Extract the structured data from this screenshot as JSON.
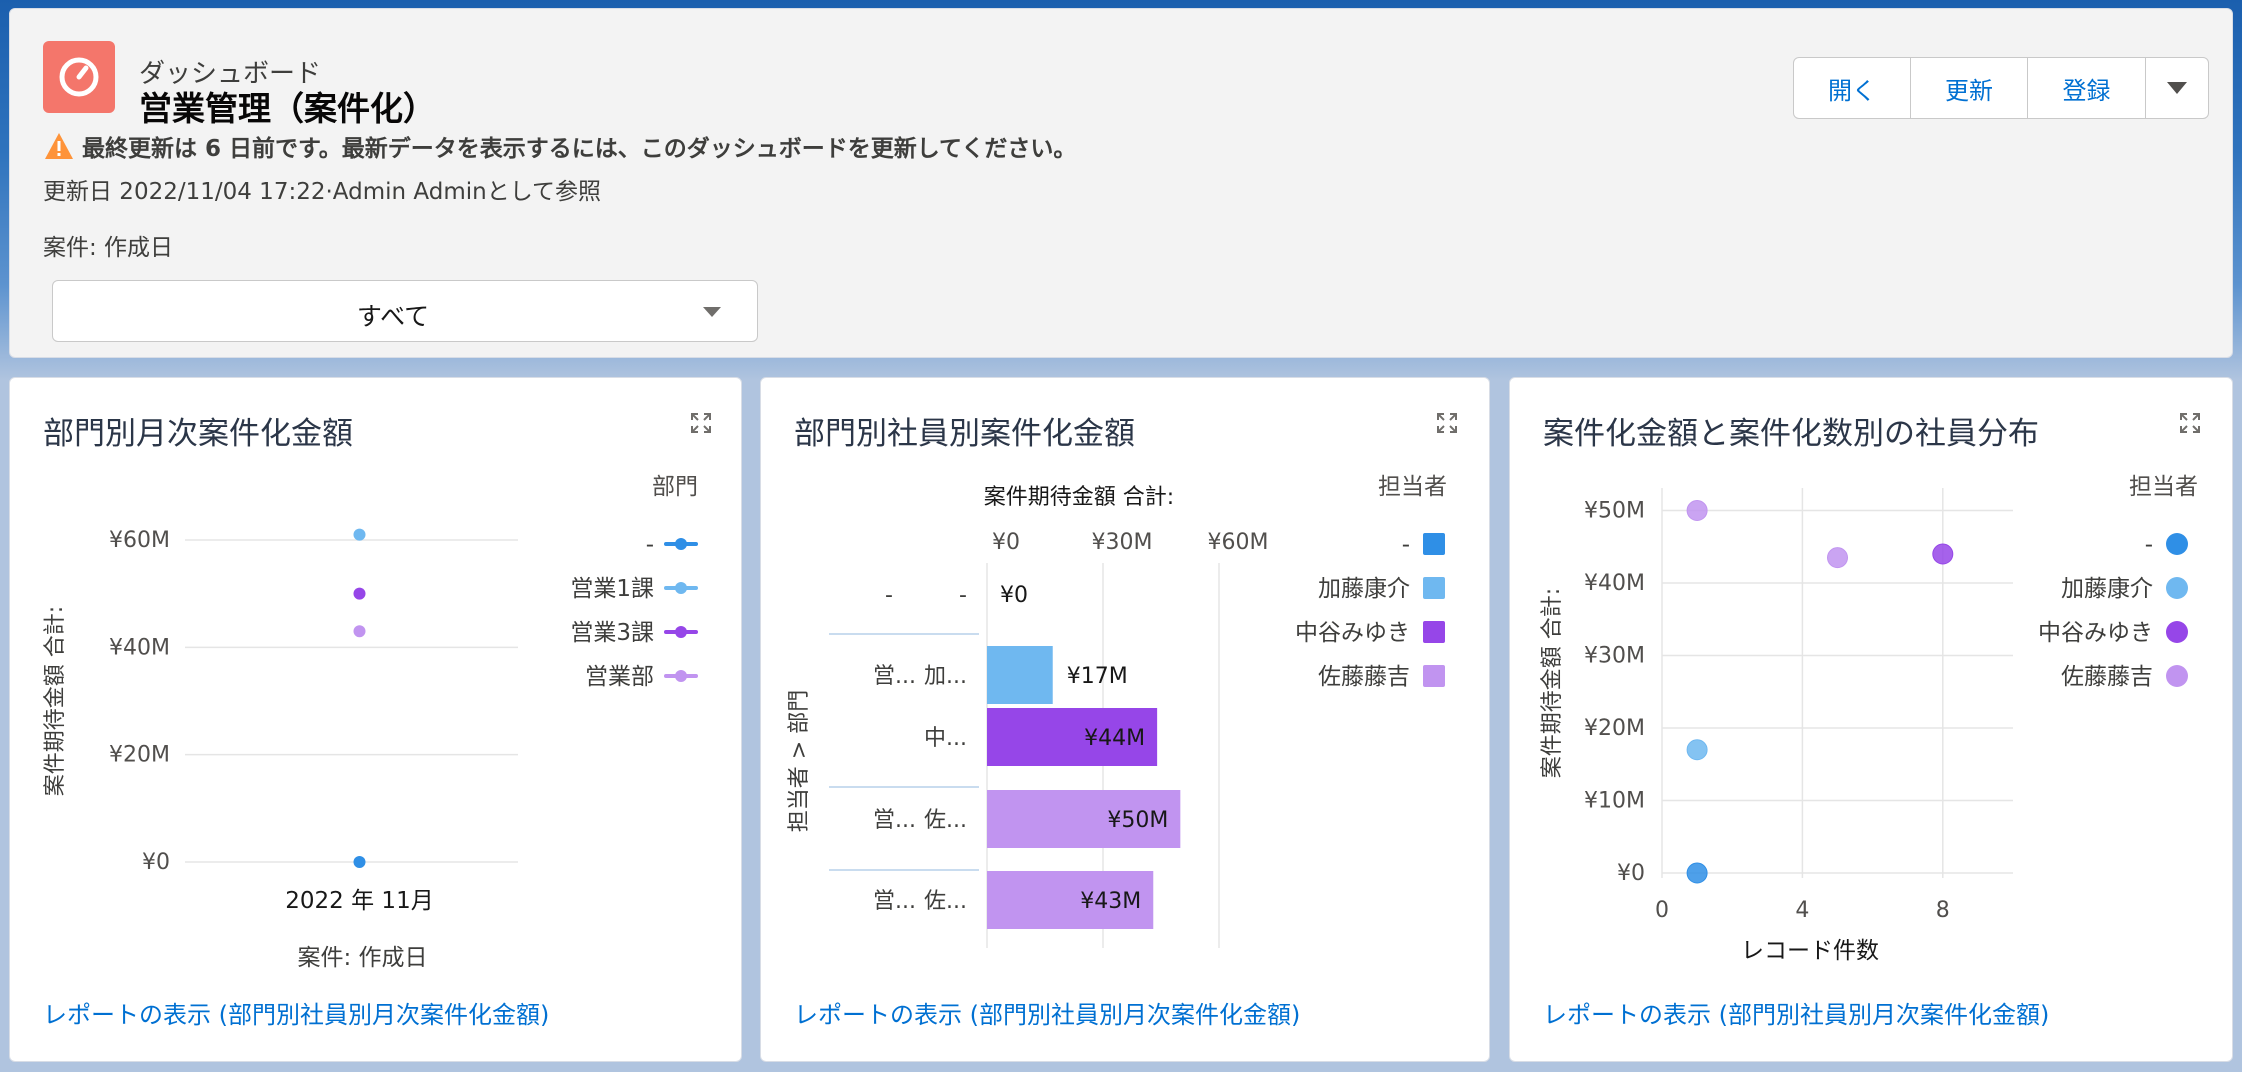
{
  "header": {
    "subtitle": "ダッシュボード",
    "title": "営業管理（案件化）",
    "warning": "最終更新は 6 日前です。最新データを表示するには、このダッシュボードを更新してください。",
    "updated": "更新日 2022/11/04 17:22·Admin Adminとして参照",
    "filter_label": "案件: 作成日",
    "filter_value": "すべて",
    "buttons": {
      "open": "開く",
      "refresh": "更新",
      "subscribe": "登録"
    }
  },
  "widgets": [
    {
      "title": "部門別月次案件化金額",
      "link": "レポートの表示 (部門別社員別月次案件化金額)",
      "chart_data": {
        "type": "scatter",
        "title": "部門別月次案件化金額",
        "xlabel": "案件: 作成日",
        "ylabel": "案件期待金額 合計:",
        "categories": [
          "2022 年 11月"
        ],
        "y_ticks": [
          "¥0",
          "¥20M",
          "¥40M",
          "¥60M"
        ],
        "ylim": [
          0,
          60
        ],
        "legend_title": "部門",
        "legend_position": "right",
        "series": [
          {
            "name": "-",
            "color": "#2f8fe6",
            "values": [
              0
            ]
          },
          {
            "name": "営業1課",
            "color": "#6fb8f0",
            "values": [
              61
            ]
          },
          {
            "name": "営業3課",
            "color": "#9646e8",
            "values": [
              50
            ]
          },
          {
            "name": "営業部",
            "color": "#c194f0",
            "values": [
              43
            ]
          }
        ]
      }
    },
    {
      "title": "部門別社員別案件化金額",
      "link": "レポートの表示 (部門別社員別月次案件化金額)",
      "chart_data": {
        "type": "bar",
        "title": "部門別社員別案件化金額",
        "xlabel": "案件期待金額 合計:",
        "ylabel": "担当者 > 部門",
        "x_ticks": [
          "¥0",
          "¥30M",
          "¥60M"
        ],
        "xlim": [
          0,
          60
        ],
        "legend_title": "担当者",
        "legend_position": "right",
        "rows": [
          {
            "dept": "-",
            "person": "-",
            "value": 0,
            "label": "¥0",
            "color": "#2f8fe6"
          },
          {
            "dept": "営...",
            "person": "加...",
            "value": 17,
            "label": "¥17M",
            "color": "#6fb8f0"
          },
          {
            "dept": "",
            "person": "中...",
            "value": 44,
            "label": "¥44M",
            "color": "#9646e8"
          },
          {
            "dept": "営...",
            "person": "佐...",
            "value": 50,
            "label": "¥50M",
            "color": "#c194f0"
          },
          {
            "dept": "営...",
            "person": "佐...",
            "value": 43,
            "label": "¥43M",
            "color": "#c194f0"
          }
        ],
        "legend": [
          {
            "name": "-",
            "color": "#2f8fe6"
          },
          {
            "name": "加藤康介",
            "color": "#6fb8f0"
          },
          {
            "name": "中谷みゆき",
            "color": "#9646e8"
          },
          {
            "name": "佐藤藤吉",
            "color": "#c194f0"
          }
        ]
      }
    },
    {
      "title": "案件化金額と案件化数別の社員分布",
      "link": "レポートの表示 (部門別社員別月次案件化金額)",
      "chart_data": {
        "type": "scatter",
        "title": "案件化金額と案件化数別の社員分布",
        "xlabel": "レコード件数",
        "ylabel": "案件期待金額 合計:",
        "x_ticks": [
          "0",
          "4",
          "8"
        ],
        "xlim": [
          0,
          10
        ],
        "y_ticks": [
          "¥0",
          "¥10M",
          "¥20M",
          "¥30M",
          "¥40M",
          "¥50M"
        ],
        "ylim": [
          0,
          52
        ],
        "legend_title": "担当者",
        "legend_position": "right",
        "series": [
          {
            "name": "-",
            "color": "#2f8fe6",
            "points": [
              [
                1,
                0
              ]
            ]
          },
          {
            "name": "加藤康介",
            "color": "#6fb8f0",
            "points": [
              [
                1,
                17
              ]
            ]
          },
          {
            "name": "中谷みゆき",
            "color": "#9646e8",
            "points": [
              [
                8,
                44
              ]
            ]
          },
          {
            "name": "佐藤藤吉",
            "color": "#c194f0",
            "points": [
              [
                1,
                50
              ],
              [
                5,
                43.5
              ]
            ]
          }
        ]
      }
    }
  ]
}
